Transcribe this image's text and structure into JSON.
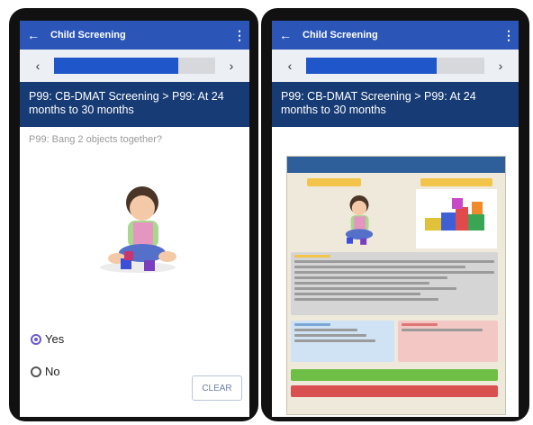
{
  "left_screen": {
    "app_title": "Child Screening",
    "back_icon": "arrow-left-icon",
    "menu_icon": "more-vert-icon",
    "nav": {
      "prev": "‹",
      "next": "›",
      "progress": 0.77
    },
    "header": "P99: CB-DMAT Screening > P99: At 24 months to 30 months",
    "question": "P99: Bang 2 objects together?",
    "options": [
      {
        "label": "Yes",
        "selected": true
      },
      {
        "label": "No",
        "selected": false
      }
    ],
    "clear_label": "CLEAR"
  },
  "right_screen": {
    "app_title": "Child Screening",
    "back_icon": "arrow-left-icon",
    "menu_icon": "more-vert-icon",
    "nav": {
      "prev": "‹",
      "next": "›",
      "progress": 0.73
    },
    "header": "P99: CB-DMAT Screening > P99: At 24 months to 30 months"
  },
  "colors": {
    "appbar": "#2b56b8",
    "header": "#173b74",
    "progress_fill": "#1f56c9",
    "radio_selected": "#6a5acd"
  }
}
